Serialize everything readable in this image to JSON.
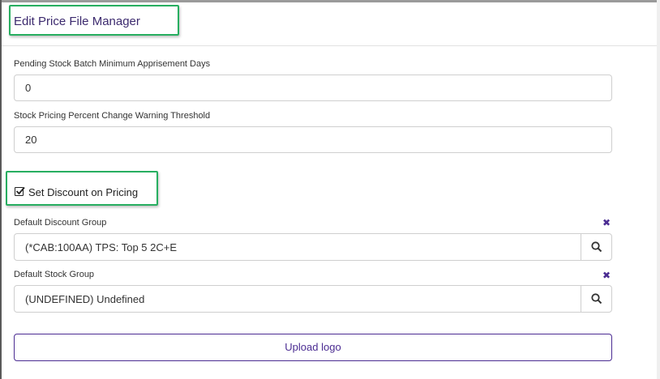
{
  "header": {
    "title": "Edit Price File Manager"
  },
  "fields": {
    "min_apprisement_days": {
      "label": "Pending Stock Batch Minimum Apprisement Days",
      "value": "0"
    },
    "percent_change_threshold": {
      "label": "Stock Pricing Percent Change Warning Threshold",
      "value": "20"
    }
  },
  "discount": {
    "checkbox_label": "Set Discount on Pricing",
    "checked": true
  },
  "default_discount_group": {
    "label": "Default Discount Group",
    "value": "(*CAB:100AA) TPS: Top 5 2C+E"
  },
  "default_stock_group": {
    "label": "Default Stock Group",
    "value": "(UNDEFINED) Undefined"
  },
  "upload": {
    "label": "Upload logo"
  },
  "icons": {
    "clear": "close-icon",
    "search": "search-icon",
    "check": "checkbox-checked-icon"
  },
  "colors": {
    "accent": "#4b2c92",
    "highlight_border": "#27ae60",
    "title": "#3c2a6e"
  }
}
